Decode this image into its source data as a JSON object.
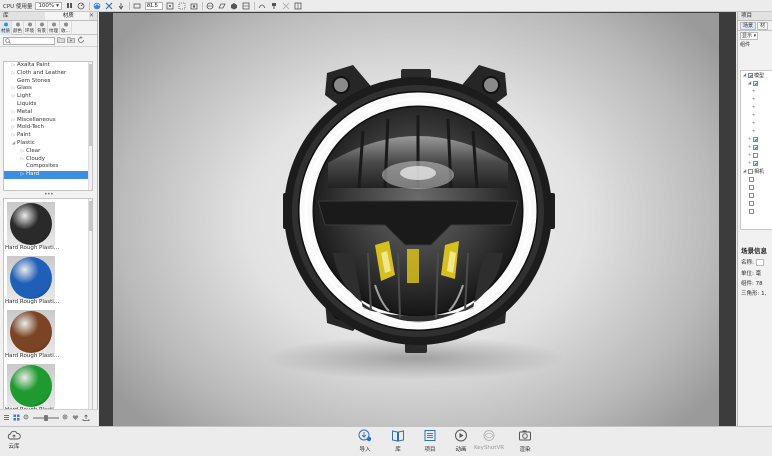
{
  "toolbar": {
    "cpu_label": "CPU 使用量",
    "cpu_value": "100%",
    "resolution_value": "81.5"
  },
  "library": {
    "panel_title": "库",
    "active_tab_title": "材质",
    "tabs": [
      {
        "label": "材质",
        "icon": "material-icon"
      },
      {
        "label": "颜色",
        "icon": "color-icon"
      },
      {
        "label": "环境",
        "icon": "environment-icon"
      },
      {
        "label": "背景",
        "icon": "background-icon"
      },
      {
        "label": "纹理",
        "icon": "texture-icon"
      },
      {
        "label": "收...",
        "icon": "favorites-icon"
      }
    ],
    "search_value": "",
    "tree": [
      {
        "label": "Axalta Paint",
        "level": 0,
        "arrow": "▷"
      },
      {
        "label": "Cloth and Leather",
        "level": 0,
        "arrow": "▷"
      },
      {
        "label": "Gem Stones",
        "level": 0,
        "arrow": ""
      },
      {
        "label": "Glass",
        "level": 0,
        "arrow": "▷"
      },
      {
        "label": "Light",
        "level": 0,
        "arrow": "▷"
      },
      {
        "label": "Liquids",
        "level": 0,
        "arrow": ""
      },
      {
        "label": "Metal",
        "level": 0,
        "arrow": "▷"
      },
      {
        "label": "Miscellaneous",
        "level": 0,
        "arrow": "▷"
      },
      {
        "label": "Mold-Tech",
        "level": 0,
        "arrow": "▷"
      },
      {
        "label": "Paint",
        "level": 0,
        "arrow": "▷"
      },
      {
        "label": "Plastic",
        "level": 0,
        "arrow": "◢"
      },
      {
        "label": "Clear",
        "level": 1,
        "arrow": "▷"
      },
      {
        "label": "Cloudy",
        "level": 1,
        "arrow": "▷"
      },
      {
        "label": "Composites",
        "level": 1,
        "arrow": ""
      },
      {
        "label": "Hard",
        "level": 1,
        "arrow": "▷",
        "selected": true
      }
    ],
    "ellipsis": "•••",
    "thumbnails": [
      {
        "label": "Hard Rough Plasti...",
        "color": "#2a2a2a"
      },
      {
        "label": "Hard Rough Plasti...",
        "color": "#1f5fb8"
      },
      {
        "label": "Hard Rough Plasti...",
        "color": "#7a4425"
      },
      {
        "label": "Hard Rough Plasti...",
        "color": "#1f9a2e"
      }
    ]
  },
  "project": {
    "panel_title": "项目",
    "tabs": [
      "场景",
      "材"
    ],
    "show_label": "显示",
    "group_label": "组件",
    "model_label": "模型",
    "camera_label": "相机",
    "info_title": "场景信息",
    "name_label": "名称:",
    "unit_label": "单位:",
    "unit_value": "毫",
    "group_count_label": "组件:",
    "group_count_value": "78",
    "triangles_label": "三角形:",
    "triangles_value": "1,"
  },
  "dock": {
    "cloud_label": "云库",
    "buttons": [
      {
        "label": "导入",
        "icon": "import-icon",
        "enabled": true
      },
      {
        "label": "库",
        "icon": "library-book-icon",
        "enabled": true
      },
      {
        "label": "项目",
        "icon": "project-list-icon",
        "enabled": true
      },
      {
        "label": "动画",
        "icon": "animation-play-icon",
        "enabled": true
      },
      {
        "label": "KeyShotVR",
        "icon": "keyshotvr-icon",
        "enabled": false
      },
      {
        "label": "渲染",
        "icon": "render-camera-icon",
        "enabled": true
      }
    ]
  },
  "colors": {
    "accent": "#3d8ee1",
    "dock_icon": "#2f6fb6",
    "amber_led": "#d6c01f"
  }
}
